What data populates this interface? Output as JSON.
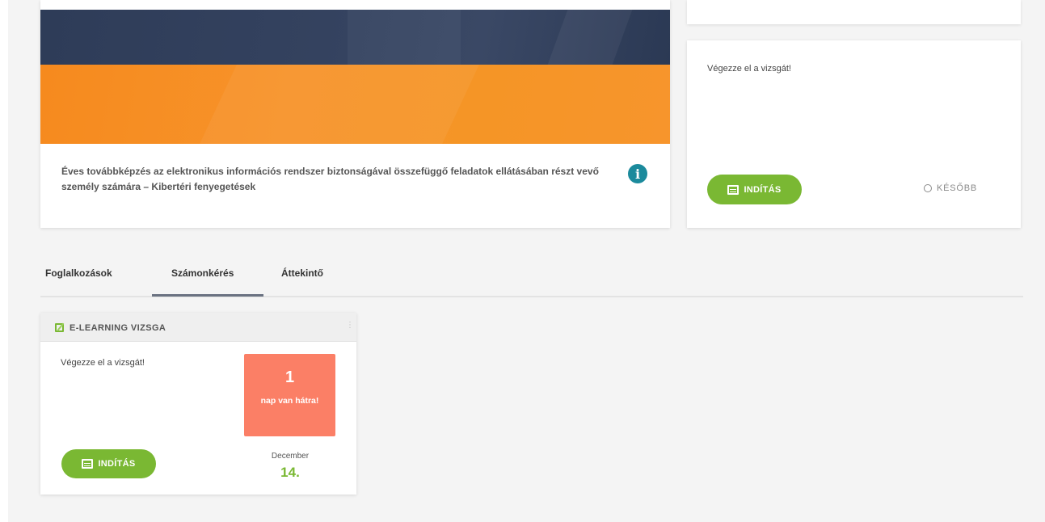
{
  "hero": {
    "description": "Éves továbbképzés az elektronikus információs rendszer biztonságával összefüggő feladatok ellátásában részt vevő személy számára – Kibertéri fenyegetések",
    "info_icon": "info-circle-icon"
  },
  "exam_panel": {
    "message": "Végezze el a vizsgát!",
    "start_label": "INDÍTÁS",
    "later_label": "KÉSŐBB"
  },
  "tabs": [
    {
      "label": "Foglalkozások",
      "active": false
    },
    {
      "label": "Számonkérés",
      "active": true
    },
    {
      "label": "Áttekintő",
      "active": false
    }
  ],
  "vizsga_card": {
    "title": "E-LEARNING VIZSGA",
    "message": "Végezze el a vizsgát!",
    "countdown_number": "1",
    "countdown_label": "nap van hátra!",
    "start_label": "INDÍTÁS",
    "due_month": "December",
    "due_day": "14."
  },
  "colors": {
    "accent_green": "#7ab833",
    "countdown_red": "#fb7f66",
    "banner_orange": "#f7932a",
    "banner_navy": "#34425f",
    "info_teal": "#1b8a9c"
  }
}
